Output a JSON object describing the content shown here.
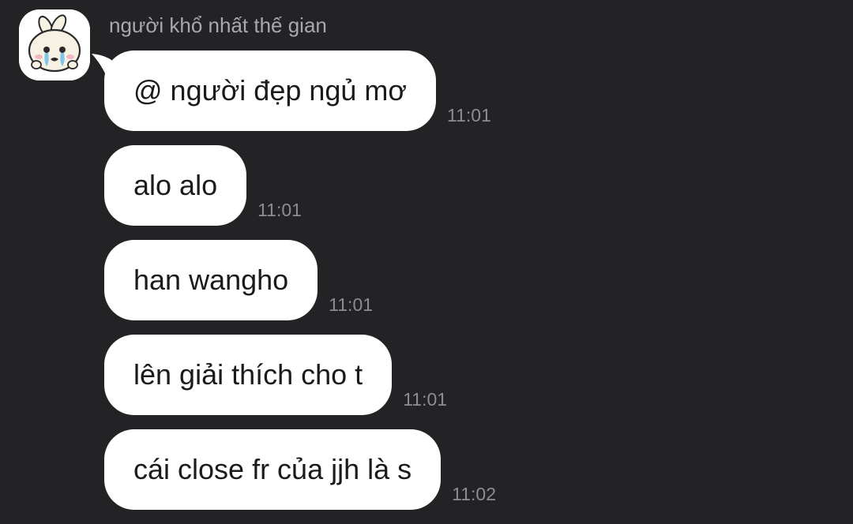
{
  "sender": {
    "name": "người khổ nhất thế gian",
    "avatar_icon": "crying-bunny-avatar-icon"
  },
  "messages": [
    {
      "text": "@ người đẹp ngủ mơ",
      "time": "11:01"
    },
    {
      "text": "alo alo",
      "time": "11:01"
    },
    {
      "text": "han wangho",
      "time": "11:01"
    },
    {
      "text": "lên giải thích cho t",
      "time": "11:01"
    },
    {
      "text": "cái close fr của jjh là s",
      "time": "11:02"
    }
  ],
  "colors": {
    "background": "#232325",
    "bubble": "#ffffff",
    "bubble_text": "#1b1b1b",
    "meta_text": "#8d8d91",
    "name_text": "#a9a9ad"
  }
}
